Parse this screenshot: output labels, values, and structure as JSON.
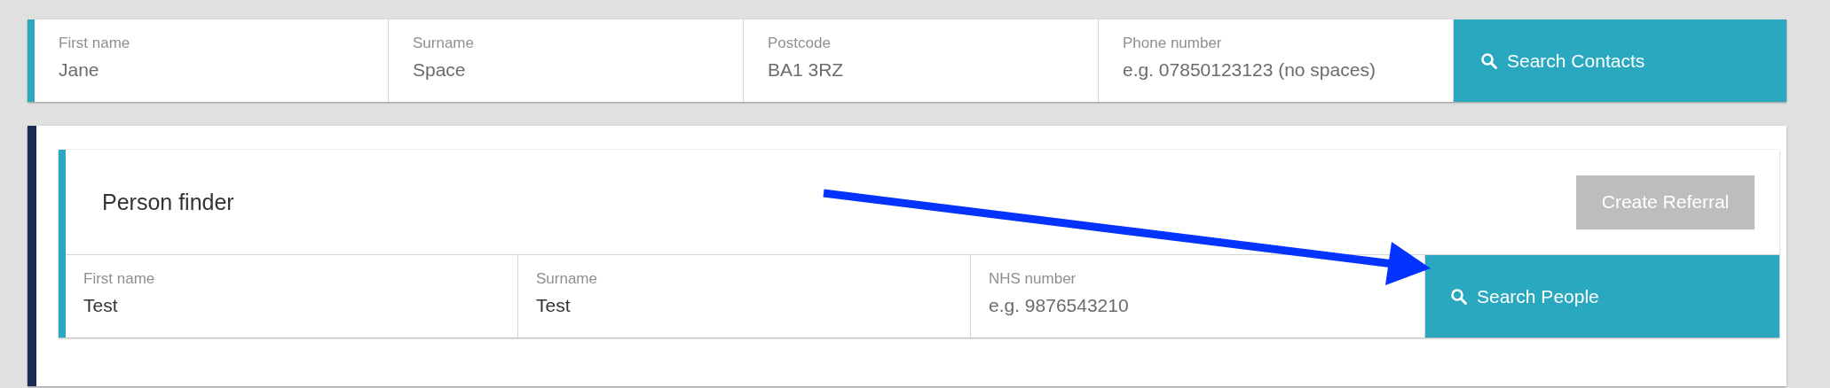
{
  "contact_search": {
    "fields": [
      {
        "label": "First name",
        "value": "Jane"
      },
      {
        "label": "Surname",
        "value": "Space"
      },
      {
        "label": "Postcode",
        "value": "BA1 3RZ"
      },
      {
        "label": "Phone number",
        "placeholder": "e.g. 07850123123 (no spaces)"
      }
    ],
    "button": {
      "label": "Search Contacts"
    }
  },
  "person_finder": {
    "title": "Person finder",
    "create_button": {
      "label": "Create Referral",
      "disabled": true
    },
    "fields": [
      {
        "label": "First name",
        "value": "Test"
      },
      {
        "label": "Surname",
        "value": "Test"
      },
      {
        "label": "NHS number",
        "placeholder": "e.g. 9876543210"
      }
    ],
    "button": {
      "label": "Search People"
    }
  }
}
